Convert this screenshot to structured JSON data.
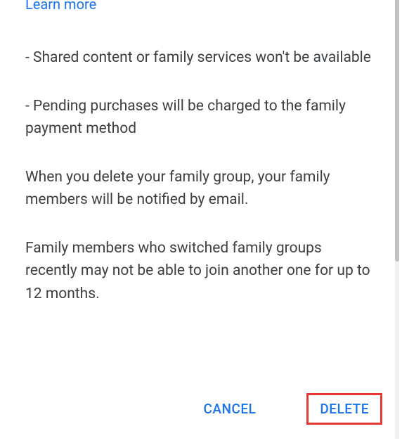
{
  "dialog": {
    "learn_more": "Learn more",
    "bullets": [
      "- Shared content or family services won't be available",
      "- Pending purchases will be charged to the family payment method"
    ],
    "paragraphs": [
      "When you delete your family group, your family members will be notified by email.",
      "Family members who switched family groups recently may not be able to join another one for up to 12 months."
    ],
    "actions": {
      "cancel": "CANCEL",
      "delete": "DELETE"
    }
  }
}
